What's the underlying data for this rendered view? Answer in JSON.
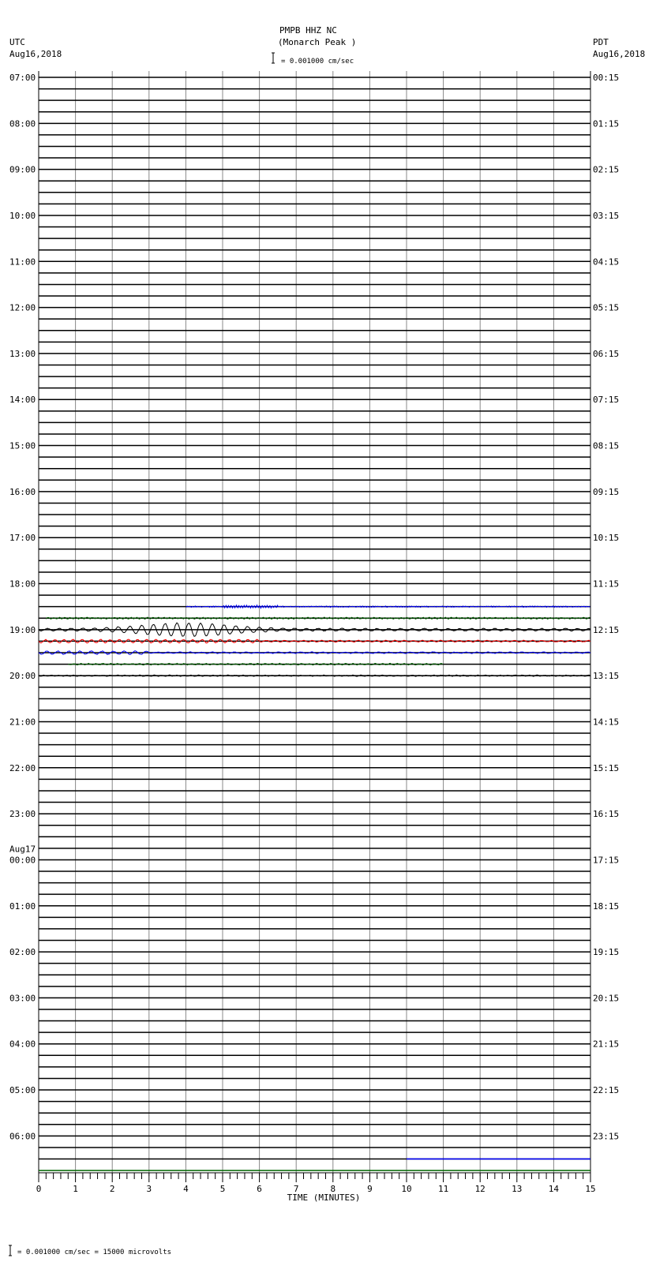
{
  "chart_data": {
    "type": "helicorder",
    "title": "PMPB HHZ NC",
    "subtitle": "(Monarch Peak )",
    "left_tz": "UTC",
    "left_date": "Aug16,2018",
    "right_tz": "PDT",
    "right_date": "Aug16,2018",
    "scale_label": "= 0.001000 cm/sec",
    "footer": "= 0.001000 cm/sec =   15000 microvolts",
    "xlabel": "TIME (MINUTES)",
    "xlim": [
      0,
      15
    ],
    "x_ticks": [
      "0",
      "1",
      "2",
      "3",
      "4",
      "5",
      "6",
      "7",
      "8",
      "9",
      "10",
      "11",
      "12",
      "13",
      "14",
      "15"
    ],
    "minutes_per_line": 15,
    "trace_colors": [
      "#000000",
      "#ff0000",
      "#0000ff",
      "#006400"
    ],
    "left_labels": [
      "07:00",
      "08:00",
      "09:00",
      "10:00",
      "11:00",
      "12:00",
      "13:00",
      "14:00",
      "15:00",
      "16:00",
      "17:00",
      "18:00",
      "19:00",
      "20:00",
      "21:00",
      "22:00",
      "23:00",
      "00:00",
      "01:00",
      "02:00",
      "03:00",
      "04:00",
      "05:00",
      "06:00"
    ],
    "date_change_label": "Aug17",
    "right_labels": [
      "00:15",
      "01:15",
      "02:15",
      "03:15",
      "04:15",
      "05:15",
      "06:15",
      "07:15",
      "08:15",
      "09:15",
      "10:15",
      "11:15",
      "12:15",
      "13:15",
      "14:15",
      "15:15",
      "16:15",
      "17:15",
      "18:15",
      "19:15",
      "20:15",
      "21:15",
      "22:15",
      "23:15"
    ],
    "event": {
      "start_utc": "18:30",
      "peak_line_utc": "19:00",
      "peak_minute": 4,
      "peak_amplitude_scale_units": 1.0
    },
    "last_data_minute_on_final_blue_line": 10
  }
}
